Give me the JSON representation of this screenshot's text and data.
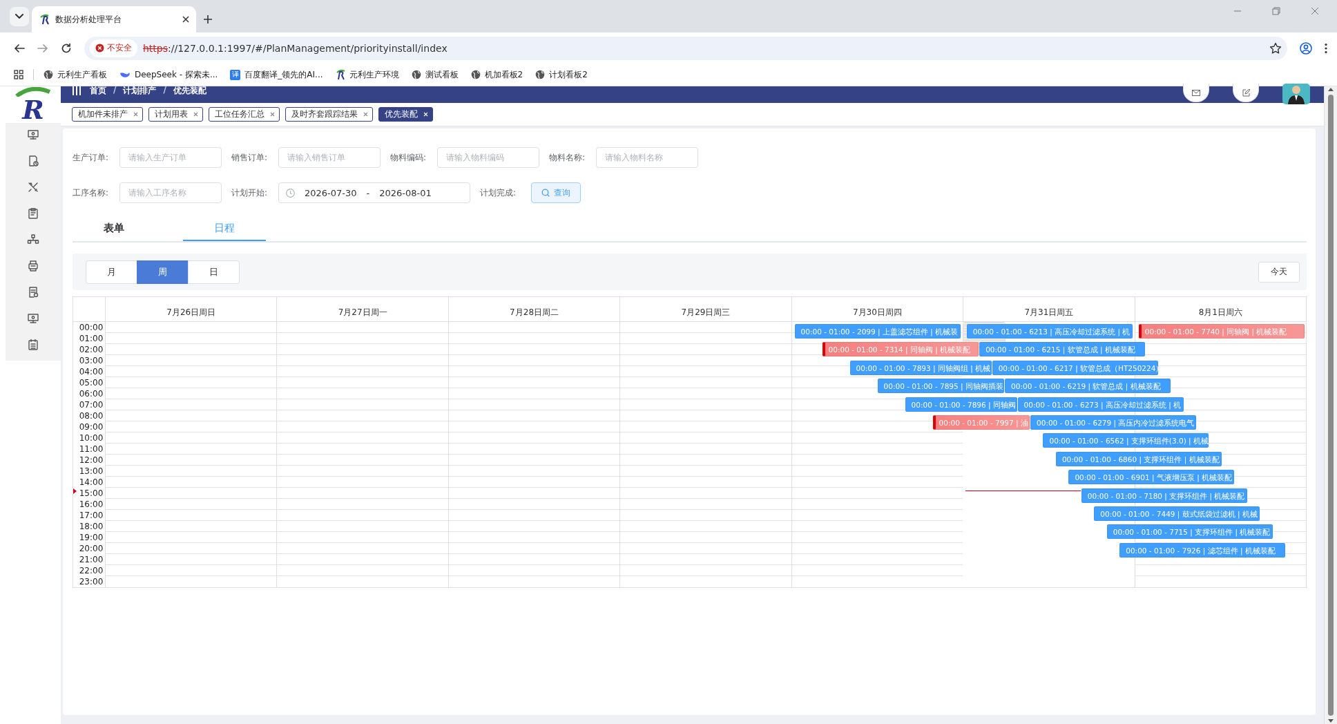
{
  "browser": {
    "tab_title": "数据分析处理平台",
    "security": "不安全",
    "url_scheme": "https",
    "url_rest": "://127.0.0.1:1997/#/PlanManagement/priorityinstall/index",
    "bookmarks": [
      {
        "label": "元利生产看板",
        "kind": "globe"
      },
      {
        "label": "DeepSeek - 探索未...",
        "kind": "whale"
      },
      {
        "label": "百度翻译_领先的AI...",
        "kind": "badge",
        "badge": "译"
      },
      {
        "label": "元利生产环境",
        "kind": "logo"
      },
      {
        "label": "测试看板",
        "kind": "globe"
      },
      {
        "label": "机加看板2",
        "kind": "globe"
      },
      {
        "label": "计划看板2",
        "kind": "globe"
      }
    ]
  },
  "app": {
    "logo": "R",
    "breadcrumb": [
      "首页",
      "计划排产",
      "优先装配"
    ],
    "breadcrumb_separator": "/"
  },
  "tags": [
    {
      "label": "机加件未排产",
      "selected": false
    },
    {
      "label": "计划用表",
      "selected": false
    },
    {
      "label": "工位任务汇总",
      "selected": false
    },
    {
      "label": "及时齐套跟踪结果",
      "selected": false
    },
    {
      "label": "优先装配",
      "selected": true
    }
  ],
  "filters": [
    [
      {
        "kind": "text",
        "label": "生产订单:",
        "placeholder": "请输入生产订单"
      },
      {
        "kind": "text",
        "label": "销售订单:",
        "placeholder": "请输入销售订单"
      },
      {
        "kind": "text",
        "label": "物料编码:",
        "placeholder": "请输入物料编码"
      },
      {
        "kind": "text",
        "label": "物料名称:",
        "placeholder": "请输入物料名称"
      }
    ],
    [
      {
        "kind": "text",
        "label": "工序名称:",
        "placeholder": "请输入工序名称"
      },
      {
        "kind": "daterange",
        "label": "计划开始:",
        "start": "2026-07-30",
        "separator": "-",
        "end": "2026-08-01"
      },
      {
        "kind": "button",
        "label": "计划完成:",
        "button": "查询"
      }
    ]
  ],
  "view_tabs": [
    {
      "label": "表单",
      "selected": false
    },
    {
      "label": "日程",
      "selected": true
    }
  ],
  "calendar": {
    "modes": [
      {
        "label": "月",
        "selected": false
      },
      {
        "label": "周",
        "selected": true
      },
      {
        "label": "日",
        "selected": false
      }
    ],
    "today_button": "今天",
    "hours": [
      "00:00",
      "01:00",
      "02:00",
      "03:00",
      "04:00",
      "05:00",
      "06:00",
      "07:00",
      "08:00",
      "09:00",
      "10:00",
      "11:00",
      "12:00",
      "13:00",
      "14:00",
      "15:00",
      "16:00",
      "17:00",
      "18:00",
      "19:00",
      "20:00",
      "21:00",
      "22:00",
      "23:00"
    ],
    "days": [
      {
        "label": "7月26日周日",
        "today": false
      },
      {
        "label": "7月27日周一",
        "today": false
      },
      {
        "label": "7月28日周二",
        "today": false
      },
      {
        "label": "7月29日周三",
        "today": false
      },
      {
        "label": "7月30日周四",
        "today": false,
        "events": [
          {
            "text": "00:00 - 01:00 - 2099 | 上盖滤芯组件 | 机械装",
            "color": "#409eff",
            "warning": false
          },
          {
            "text": "00:00 - 01:00 - 7314 | 同轴阀 | 机械装配",
            "color": "#f77f7f",
            "warning": true
          },
          {
            "text": "00:00 - 01:00 - 7893 | 同轴阀组 | 机械",
            "color": "#409eff",
            "warning": false
          },
          {
            "text": "00:00 - 01:00 - 7895 | 同轴阀插装",
            "color": "#409eff",
            "warning": false
          },
          {
            "text": "00:00 - 01:00 - 7896 | 同轴阀",
            "color": "#409eff",
            "warning": false
          },
          {
            "text": "00:00 - 01:00 - 7997 | 油",
            "color": "#f77f7f",
            "warning": true
          }
        ]
      },
      {
        "label": "7月31日周五",
        "today": true,
        "events": [
          {
            "text": "00:00 - 01:00 - 6213 | 高压冷却过滤系统 | 机",
            "color": "#409eff",
            "warning": false
          },
          {
            "text": "00:00 - 01:00 - 6215 | 软管总成 | 机械装配",
            "color": "#409eff",
            "warning": false
          },
          {
            "text": "00:00 - 01:00 - 6217 | 软管总成（HT250224）",
            "color": "#409eff",
            "warning": false
          },
          {
            "text": "00:00 - 01:00 - 6219 | 软管总成 | 机械装配",
            "color": "#409eff",
            "warning": false
          },
          {
            "text": "00:00 - 01:00 - 6273 | 高压冷却过滤系统 | 机",
            "color": "#409eff",
            "warning": false
          },
          {
            "text": "00:00 - 01:00 - 6279 | 高压内冷过滤系统电气",
            "color": "#409eff",
            "warning": false
          },
          {
            "text": "00:00 - 01:00 - 6562 | 支撑环组件(3.0) | 机械",
            "color": "#409eff",
            "warning": false
          },
          {
            "text": "00:00 - 01:00 - 6860 | 支撑环组件 | 机械装配",
            "color": "#409eff",
            "warning": false
          },
          {
            "text": "00:00 - 01:00 - 6901 | 气液增压泵 | 机械装配",
            "color": "#409eff",
            "warning": false
          },
          {
            "text": "00:00 - 01:00 - 7180 | 支撑环组件 | 机械装配",
            "color": "#409eff",
            "warning": false
          },
          {
            "text": "00:00 - 01:00 - 7449 | 鼓式纸袋过滤机 | 机械",
            "color": "#409eff",
            "warning": false
          },
          {
            "text": "00:00 - 01:00 - 7715 | 支撑环组件 | 机械装配",
            "color": "#409eff",
            "warning": false
          },
          {
            "text": "00:00 - 01:00 - 7926 | 滤芯组件 | 机械装配",
            "color": "#409eff",
            "warning": false
          }
        ]
      },
      {
        "label": "8月1日周六",
        "today": false,
        "events": [
          {
            "text": "00:00 - 01:00 - 7740 | 同轴阀 | 机械装配",
            "color": "#f77f7f",
            "warning": true
          }
        ]
      }
    ]
  }
}
